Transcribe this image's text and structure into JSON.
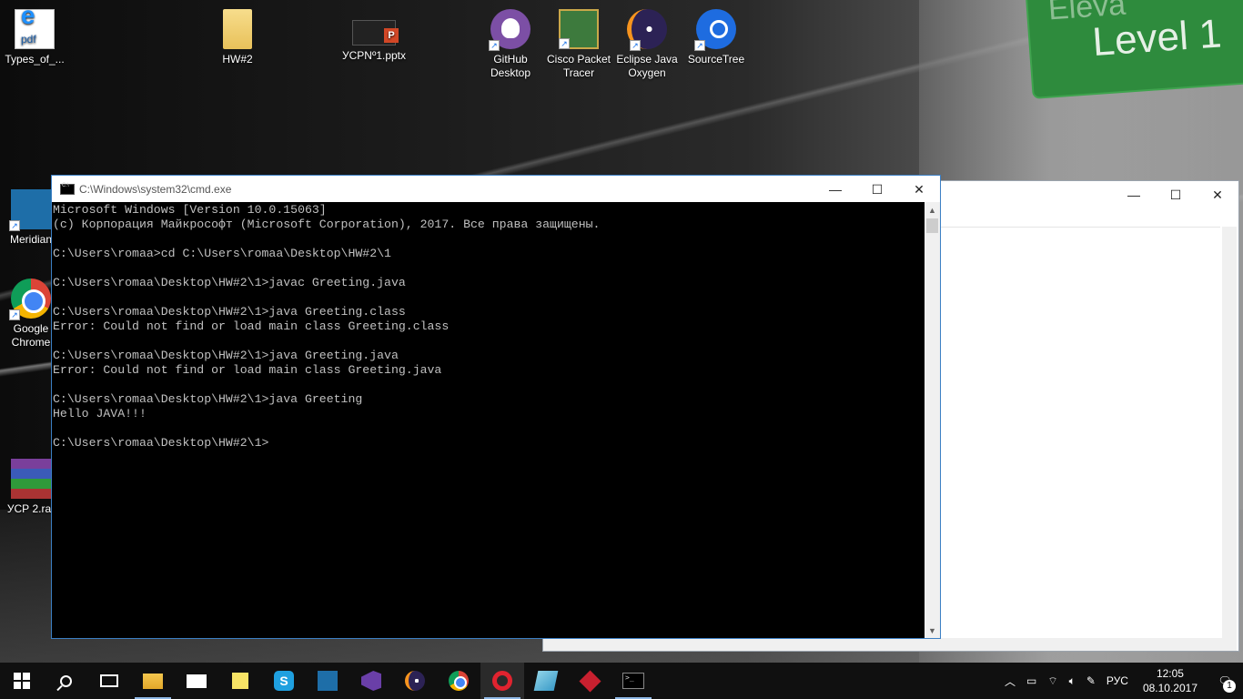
{
  "desktop": {
    "icons": [
      {
        "label": "Types_of_...",
        "icon": "pdf-file-icon"
      },
      {
        "label": "HW#2",
        "icon": "folder-icon"
      },
      {
        "label": "УСРNº1.pptx",
        "icon": "powerpoint-file-icon"
      },
      {
        "label": "GitHub Desktop",
        "icon": "github-desktop-icon"
      },
      {
        "label": "Cisco Packet Tracer",
        "icon": "cisco-packet-tracer-icon"
      },
      {
        "label": "Eclipse Java Oxygen",
        "icon": "eclipse-icon"
      },
      {
        "label": "SourceTree",
        "icon": "sourcetree-icon"
      },
      {
        "label": "Meridian",
        "icon": "meridian-icon"
      },
      {
        "label": "Google Chrome",
        "icon": "chrome-icon"
      },
      {
        "label": "УСР 2.rar",
        "icon": "winrar-archive-icon"
      }
    ],
    "wallpaper_sign": {
      "top": "Eleva",
      "main": "Level 1"
    }
  },
  "cmd_window": {
    "title": "C:\\Windows\\system32\\cmd.exe",
    "lines": [
      "Microsoft Windows [Version 10.0.15063]",
      "(c) Корпорация Майкрософт (Microsoft Corporation), 2017. Все права защищены.",
      "",
      "C:\\Users\\romaa>cd C:\\Users\\romaa\\Desktop\\HW#2\\1",
      "",
      "C:\\Users\\romaa\\Desktop\\HW#2\\1>javac Greeting.java",
      "",
      "C:\\Users\\romaa\\Desktop\\HW#2\\1>java Greeting.class",
      "Error: Could not find or load main class Greeting.class",
      "",
      "C:\\Users\\romaa\\Desktop\\HW#2\\1>java Greeting.java",
      "Error: Could not find or load main class Greeting.java",
      "",
      "C:\\Users\\romaa\\Desktop\\HW#2\\1>java Greeting",
      "Hello JAVA!!!",
      "",
      "C:\\Users\\romaa\\Desktop\\HW#2\\1>"
    ],
    "minimize": "—",
    "maximize": "☐",
    "close": "✕"
  },
  "background_window": {
    "minimize": "—",
    "maximize": "☐",
    "close": "✕"
  },
  "taskbar": {
    "apps": [
      {
        "name": "start",
        "icon": "windows-start-icon"
      },
      {
        "name": "search",
        "icon": "search-icon"
      },
      {
        "name": "task-view",
        "icon": "task-view-icon"
      },
      {
        "name": "file-explorer",
        "icon": "file-explorer-icon"
      },
      {
        "name": "mail",
        "icon": "mail-icon"
      },
      {
        "name": "sticky-notes",
        "icon": "sticky-notes-icon"
      },
      {
        "name": "skype",
        "icon": "skype-icon"
      },
      {
        "name": "meridian",
        "icon": "meridian-icon"
      },
      {
        "name": "visual-studio",
        "icon": "visual-studio-icon"
      },
      {
        "name": "eclipse",
        "icon": "eclipse-icon"
      },
      {
        "name": "chrome",
        "icon": "chrome-icon"
      },
      {
        "name": "opera",
        "icon": "opera-icon"
      },
      {
        "name": "paper",
        "icon": "paper-app-icon"
      },
      {
        "name": "git",
        "icon": "git-icon"
      },
      {
        "name": "cmd",
        "icon": "command-prompt-icon"
      }
    ],
    "tray": {
      "chevron": "︿",
      "language": "РУС",
      "time": "12:05",
      "date": "08.10.2017",
      "notification_count": "1"
    }
  },
  "colors": {
    "terminal_bg": "#000000",
    "terminal_fg": "#c0c0c0",
    "taskbar_bg": "#101010",
    "accent": "#3b7fc4"
  }
}
